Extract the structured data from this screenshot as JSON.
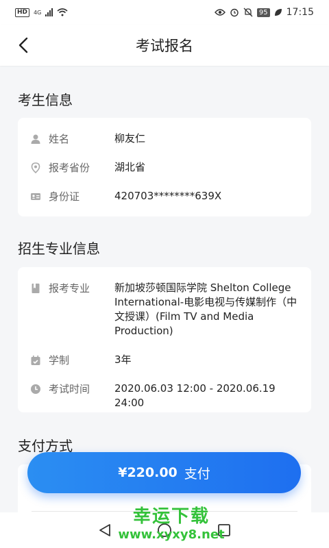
{
  "status_bar": {
    "hd": "HD",
    "network": "4G",
    "battery": "95",
    "time": "17:15"
  },
  "header": {
    "title": "考试报名"
  },
  "candidate_section": {
    "title": "考生信息",
    "rows": [
      {
        "icon": "person-icon",
        "label": "姓名",
        "value": "柳友仁"
      },
      {
        "icon": "location-pin-icon",
        "label": "报考省份",
        "value": "湖北省"
      },
      {
        "icon": "id-card-icon",
        "label": "身份证",
        "value": "420703********639X"
      }
    ]
  },
  "program_section": {
    "title": "招生专业信息",
    "rows": [
      {
        "icon": "book-icon",
        "label": "报考专业",
        "value": "新加坡莎顿国际学院 Shelton College International-电影电视与传媒制作（中文授课）(Film TV and Media Production)"
      },
      {
        "icon": "calendar-icon",
        "label": "学制",
        "value": "3年"
      },
      {
        "icon": "clock-icon",
        "label": "考试时间",
        "value": "2020.06.03 12:00 - 2020.06.19 24:00"
      }
    ]
  },
  "payment_section": {
    "title": "支付方式"
  },
  "pay_button": {
    "amount": "¥220.00",
    "label": "支付"
  },
  "watermark": {
    "name": "幸运下载",
    "url": "www.xyxy8.net"
  },
  "colors": {
    "accent": "#1e6ff0",
    "watermark": "#34c23a"
  }
}
